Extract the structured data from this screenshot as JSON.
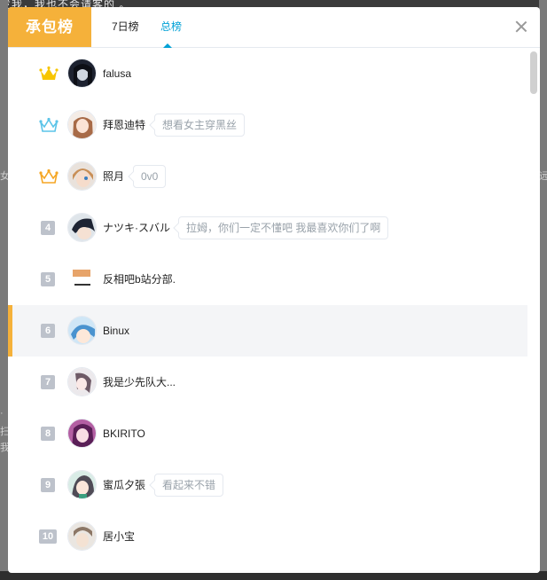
{
  "background": {
    "top_text": "发我，我也不会请客的 。",
    "left_char": "女",
    "right_char": "远",
    "left_chars_lower": [
      "·",
      "扫",
      "我"
    ]
  },
  "modal": {
    "title": "承包榜",
    "tabs": [
      {
        "label": "7日榜",
        "active": false
      },
      {
        "label": "总榜",
        "active": true
      }
    ],
    "accent_color": "#f5b13a",
    "active_tab_color": "#00a1d6"
  },
  "ranking": [
    {
      "rank": "1",
      "crown": "gold-crown-icon",
      "name": "falusa",
      "message": ""
    },
    {
      "rank": "2",
      "crown": "blue-crown-icon",
      "name": "拜恩迪特",
      "message": "想看女主穿黑丝"
    },
    {
      "rank": "3",
      "crown": "orange-crown-icon",
      "name": "照月",
      "message": "0v0"
    },
    {
      "rank": "4",
      "crown": "",
      "name": "ナツキ·スバル",
      "message": "拉姆，你们一定不懂吧 我最喜欢你们了啊"
    },
    {
      "rank": "5",
      "crown": "",
      "name": "反相吧b站分部.",
      "message": ""
    },
    {
      "rank": "6",
      "crown": "",
      "name": "Binux",
      "message": ""
    },
    {
      "rank": "7",
      "crown": "",
      "name": "我是少先队大...",
      "message": ""
    },
    {
      "rank": "8",
      "crown": "",
      "name": "BKIRITO",
      "message": ""
    },
    {
      "rank": "9",
      "crown": "",
      "name": "蜜瓜夕張",
      "message": "看起来不错"
    },
    {
      "rank": "10",
      "crown": "",
      "name": "居小宝",
      "message": ""
    }
  ],
  "highlight_rank": "6"
}
